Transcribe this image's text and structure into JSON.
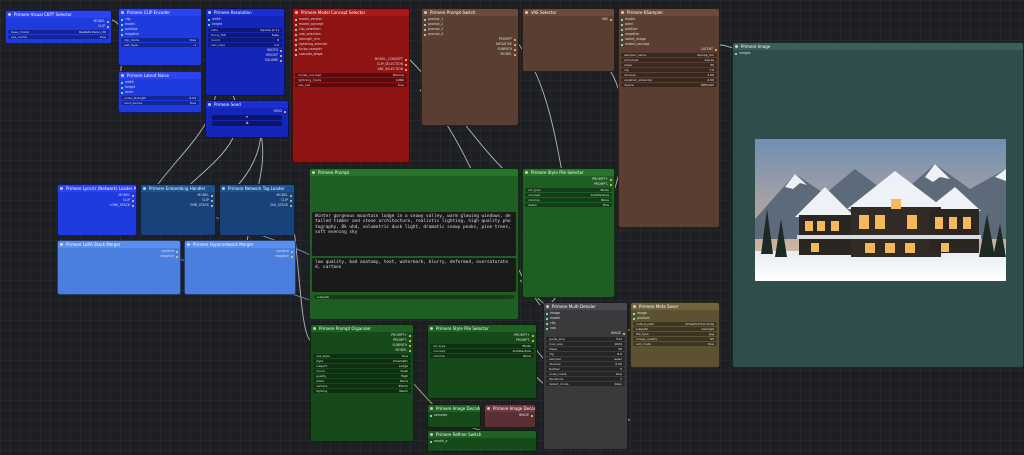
{
  "colors": {
    "canvas": "#1e1f22",
    "wire": "#c9d2dc",
    "wire_blue": "#7aa8d8",
    "wire_green": "#9ed98e"
  },
  "nodes": {
    "load_checkpoint": {
      "title": "Primere Visual CKPT Selector",
      "outputs": [
        "MODEL",
        "CLIP",
        "VAE"
      ],
      "widgets": [
        [
          "base_model",
          "RealisticVision_V6"
        ],
        [
          "use_cache",
          "true"
        ]
      ]
    },
    "clip_encoder": {
      "title": "Primere CLIP Encoder",
      "inputs": [
        "clip",
        "model",
        "positive",
        "negative"
      ],
      "widgets": [
        [
          "clip_mode",
          "true"
        ],
        [
          "last_layer",
          "-1"
        ],
        [
          "negative_strength",
          "1"
        ]
      ],
      "outputs": [
        "COND+",
        "COND-"
      ]
    },
    "resolution": {
      "title": "Primere Resolution",
      "inputs": [
        "width",
        "height"
      ],
      "widgets": [
        [
          "ratio",
          "Square [1:1]"
        ],
        [
          "force_768",
          "false"
        ],
        [
          "round",
          "8"
        ],
        [
          "calc_mpx",
          "1.0"
        ]
      ],
      "outputs": [
        "WIDTH",
        "HEIGHT",
        "SQUARE"
      ]
    },
    "model_concept": {
      "title": "Primere Model Concept Selector",
      "inputs": [
        "model_version",
        "model_concept",
        "clip_selection",
        "vae_selection",
        "strength_lcm",
        "lightning_selector",
        "turbo_sampler",
        "cascade_stage"
      ],
      "widgets": [
        [
          "model_concept",
          "Normal"
        ],
        [
          "lightning_mode",
          "LORA"
        ],
        [
          "use_vae",
          "true"
        ]
      ],
      "outputs": [
        "MODEL_CONCEPT",
        "CLIP_SELECTION",
        "VAE_SELECTION"
      ]
    },
    "latent_noise": {
      "title": "Primere Latent Noise",
      "inputs": [
        "width",
        "height",
        "seed"
      ],
      "widgets": [
        [
          "noise_strength",
          "0.03"
        ],
        [
          "rand_device",
          "true"
        ],
        [
          "expand_random",
          "false"
        ]
      ],
      "outputs": [
        "LATENTS",
        "PREVIEWS"
      ]
    },
    "prompt_switch": {
      "title": "Primere Prompt Switch",
      "inputs": [
        "prompt_1",
        "prompt_2",
        "prompt_3",
        "prompt_4"
      ],
      "outputs": [
        "PROMPT",
        "NEGATIVE",
        "SUBPATH",
        "MODEL"
      ]
    },
    "vae_selector": {
      "title": "VAE Selector",
      "outputs": [
        "VAE"
      ]
    },
    "sampler": {
      "title": "Primere KSampler",
      "inputs": [
        "model",
        "seed",
        "positive",
        "negative",
        "latent_image",
        "model_concept"
      ],
      "widgets": [
        [
          "sampler_name",
          "dpmpp_2m"
        ],
        [
          "scheduler",
          "karras"
        ],
        [
          "steps",
          "30"
        ],
        [
          "cfg",
          "7.0"
        ],
        [
          "denoise",
          "1.00"
        ],
        [
          "variation_extender",
          "0.00"
        ],
        [
          "device",
          "DEFAULT"
        ]
      ],
      "outputs": [
        "LATENT"
      ]
    },
    "save_image": {
      "title": "Primere Image",
      "inputs": [
        "images"
      ]
    },
    "styles_a": {
      "title": "Primere Lycoris (Network) Loader A",
      "outputs": [
        "MODEL",
        "CLIP",
        "LORA_STACK"
      ]
    },
    "styles_b": {
      "title": "Primere Embedding Handler",
      "outputs": [
        "MODEL",
        "CLIP",
        "EMB_STACK"
      ]
    },
    "styles_c": {
      "title": "Primere Network Tag Loader",
      "outputs": [
        "MODEL",
        "CLIP",
        "TAG_STACK"
      ]
    },
    "stack_a": {
      "title": "Primere LoRA Stack Merger",
      "outputs": [
        "positive",
        "negative"
      ]
    },
    "stack_b": {
      "title": "Primere Hypernetwork Merger",
      "outputs": [
        "positive",
        "negative"
      ]
    },
    "prompt_text": {
      "title": "Primere Prompt",
      "positive": "Winter gorgeous mountain lodge in a snowy valley, warm glowing windows, detailed timber and stone architecture, realistic lighting, high quality photography, 8k uhd, volumetric dusk light, dramatic snowy peaks, pine trees, soft evening sky",
      "negative": "low quality, bad anatomy, text, watermark, blurry, deformed, oversaturated, cartoon",
      "subpath": "subpath"
    },
    "prompt_enc": {
      "title": "Primere Prompt Organizer",
      "widgets": [
        [
          "use_style",
          "true"
        ],
        [
          "style",
          "Cinematic"
        ],
        [
          "subject",
          "Lodge"
        ],
        [
          "mood",
          "Dusk"
        ],
        [
          "quality",
          "High"
        ],
        [
          "artist",
          "None"
        ],
        [
          "camera",
          "35mm"
        ],
        [
          "lighting",
          "Warm"
        ],
        [
          "palette",
          "Natural"
        ]
      ],
      "outputs": [
        "PROMPT+",
        "PROMPT-",
        "SUBPATH",
        "MODEL"
      ]
    },
    "style_pile": {
      "title": "Primere Style Pile Selector",
      "outputs": [
        "PROMPT+",
        "PROMPT-"
      ],
      "widgets": [
        [
          "art_type",
          "Photo"
        ],
        [
          "concept",
          "Architecture"
        ],
        [
          "colorize",
          "None"
        ],
        [
          "detail",
          "Fine"
        ]
      ]
    },
    "decode": {
      "title": "Primere Image Decoder",
      "inputs": [
        "samples",
        "vae"
      ],
      "outputs": [
        "IMAGE"
      ]
    },
    "seed_node": {
      "title": "Primere Seed",
      "outputs": [
        "SEED"
      ]
    },
    "refiner": {
      "title": "Primere Refiner Switch",
      "inputs": [
        "model_a",
        "model_b"
      ]
    },
    "detailer": {
      "title": "Primere Multi-Detailer",
      "inputs": [
        "image",
        "model",
        "clip",
        "vae",
        "positive",
        "negative"
      ],
      "widgets": [
        [
          "guide_size",
          "512"
        ],
        [
          "max_size",
          "1024"
        ],
        [
          "steps",
          "20"
        ],
        [
          "cfg",
          "8.0"
        ],
        [
          "sampler",
          "euler"
        ],
        [
          "denoise",
          "0.50"
        ],
        [
          "feather",
          "5"
        ],
        [
          "noise_mask",
          "true"
        ],
        [
          "iterations",
          "1"
        ],
        [
          "detect_mode",
          "bbox"
        ]
      ],
      "outputs": [
        "IMAGE"
      ]
    },
    "meta_saver": {
      "title": "Primere Meta Saver",
      "inputs": [
        "image",
        "positive",
        "negative",
        "model",
        "seed"
      ],
      "widgets": [
        [
          "output_path",
          "[time(%Y-%m-%d)]"
        ],
        [
          "subpath",
          "Concept"
        ],
        [
          "file_type",
          "jpg"
        ],
        [
          "image_quality",
          "95"
        ],
        [
          "add_meta",
          "true"
        ],
        [
          "preview",
          "true"
        ]
      ]
    }
  }
}
